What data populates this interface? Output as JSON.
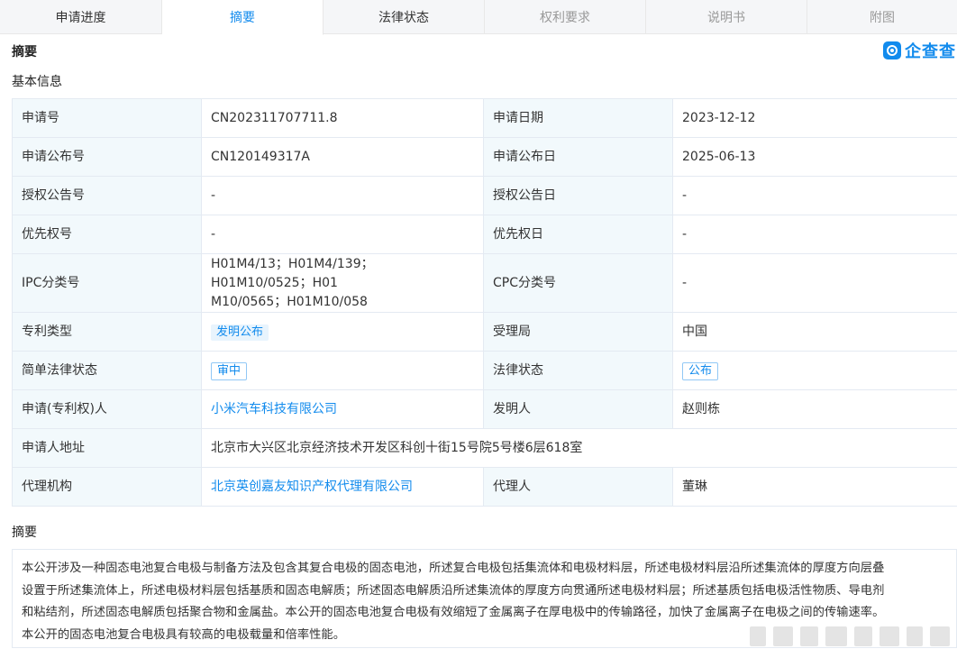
{
  "tabs": [
    {
      "label": "申请进度",
      "state": "normal"
    },
    {
      "label": "摘要",
      "state": "active"
    },
    {
      "label": "法律状态",
      "state": "normal"
    },
    {
      "label": "权利要求",
      "state": "disabled"
    },
    {
      "label": "说明书",
      "state": "disabled"
    },
    {
      "label": "附图",
      "state": "disabled"
    }
  ],
  "header": {
    "title": "摘要",
    "logo_text": "企查查"
  },
  "basic_info": {
    "title": "基本信息",
    "rows": [
      {
        "l1": "申请号",
        "v1": "CN202311707711.8",
        "l2": "申请日期",
        "v2": "2023-12-12"
      },
      {
        "l1": "申请公布号",
        "v1": "CN120149317A",
        "l2": "申请公布日",
        "v2": "2025-06-13"
      },
      {
        "l1": "授权公告号",
        "v1": "-",
        "l2": "授权公告日",
        "v2": "-"
      },
      {
        "l1": "优先权号",
        "v1": "-",
        "l2": "优先权日",
        "v2": "-"
      },
      {
        "l1": "IPC分类号",
        "v1a": "H01M4/13；H01M4/139；H01M10/0525；H01",
        "v1b": "M10/0565；H01M10/058",
        "l2": "CPC分类号",
        "v2": "-"
      },
      {
        "l1": "专利类型",
        "v1": "发明公布",
        "l2": "受理局",
        "v2": "中国"
      },
      {
        "l1": "简单法律状态",
        "v1": "审中",
        "l2": "法律状态",
        "v2": "公布"
      },
      {
        "l1": "申请(专利权)人",
        "v1": "小米汽车科技有限公司",
        "l2": "发明人",
        "v2": "赵则栋"
      },
      {
        "l1": "申请人地址",
        "v1": "北京市大兴区北京经济技术开发区科创十街15号院5号楼6层618室"
      },
      {
        "l1": "代理机构",
        "v1": "北京英创嘉友知识产权代理有限公司",
        "l2": "代理人",
        "v2": "董琳"
      }
    ]
  },
  "abstract": {
    "title": "摘要",
    "lines": [
      "本公开涉及一种固态电池复合电极与制备方法及包含其复合电极的固态电池，所述复合电极包括集流体和电极材料层，所述电极材料层沿所述集流体的厚度方向层叠",
      "设置于所述集流体上，所述电极材料层包括基质和固态电解质；所述固态电解质沿所述集流体的厚度方向贯通所述电极材料层；所述基质包括电极活性物质、导电剂",
      "和粘结剂，所述固态电解质包括聚合物和金属盐。本公开的固态电池复合电极有效缩短了金属离子在厚电极中的传输路径，加快了金属离子在电极之间的传输速率。",
      "本公开的固态电池复合电极具有较高的电极载量和倍率性能。"
    ]
  }
}
